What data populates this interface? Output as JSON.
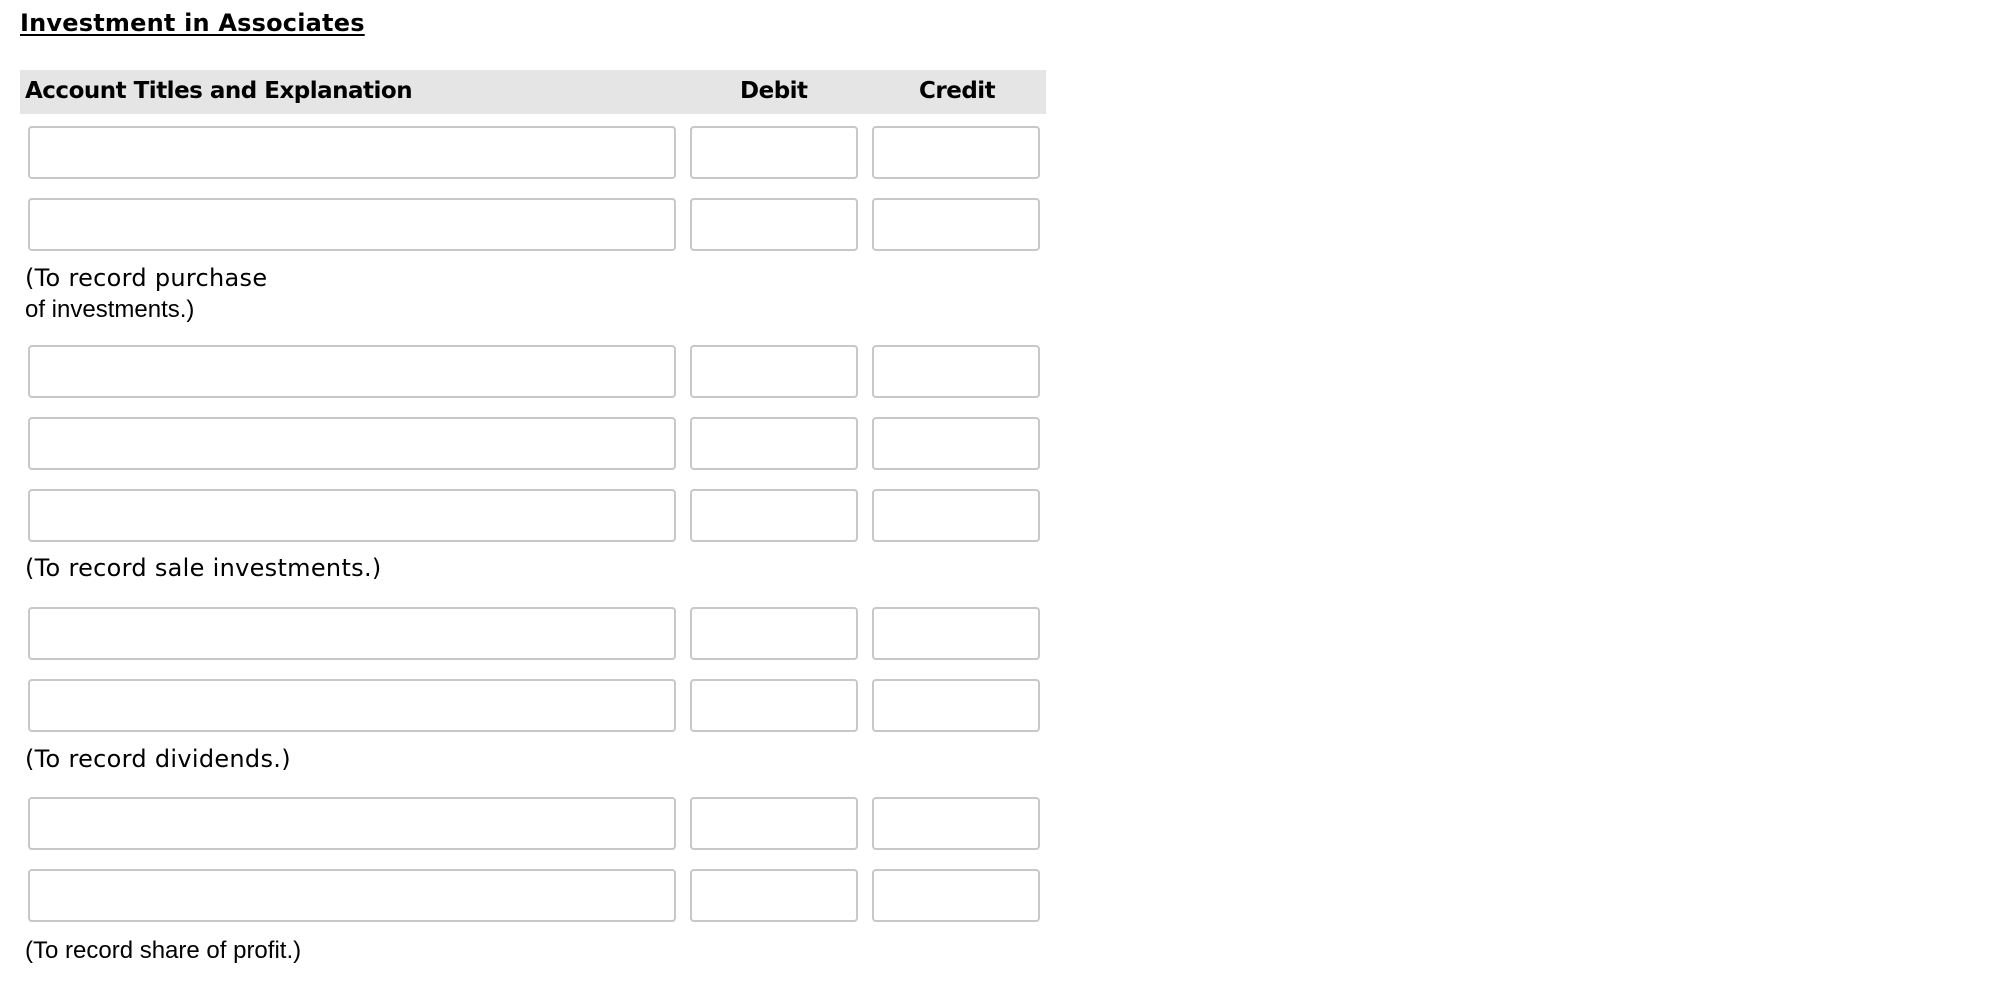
{
  "page": {
    "title": "Investment in Associates"
  },
  "table": {
    "headers": {
      "account": "Account Titles and Explanation",
      "debit": "Debit",
      "credit": "Credit"
    }
  },
  "entries": [
    {
      "rows": [
        {
          "account": "",
          "debit": "",
          "credit": ""
        },
        {
          "account": "",
          "debit": "",
          "credit": ""
        }
      ],
      "caption_line1": "(To record purchase",
      "caption_line2": "of investments.)"
    },
    {
      "rows": [
        {
          "account": "",
          "debit": "",
          "credit": ""
        },
        {
          "account": "",
          "debit": "",
          "credit": ""
        },
        {
          "account": "",
          "debit": "",
          "credit": ""
        }
      ],
      "caption_line1": "(To record sale investments.)"
    },
    {
      "rows": [
        {
          "account": "",
          "debit": "",
          "credit": ""
        },
        {
          "account": "",
          "debit": "",
          "credit": ""
        }
      ],
      "caption_line1": "(To record dividends.)"
    },
    {
      "rows": [
        {
          "account": "",
          "debit": "",
          "credit": ""
        },
        {
          "account": "",
          "debit": "",
          "credit": ""
        }
      ],
      "caption_line1": "(To record share of profit.)"
    }
  ]
}
